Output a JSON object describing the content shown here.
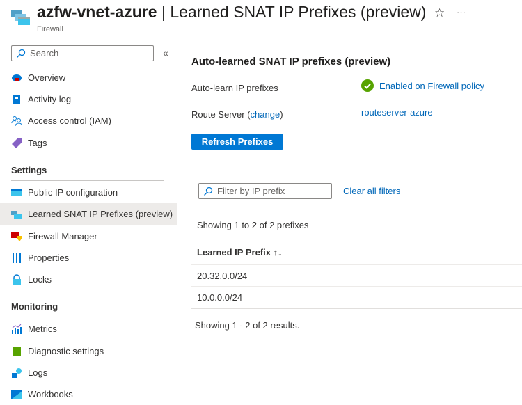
{
  "header": {
    "resource": "azfw-vnet-azure",
    "page": "Learned SNAT IP Prefixes (preview)",
    "separator": "|",
    "type": "Firewall",
    "star_icon": "☆",
    "more_icon": "···"
  },
  "sidebar": {
    "search_placeholder": "Search",
    "collapse_icon": "«",
    "items": [
      {
        "label": "Overview"
      },
      {
        "label": "Activity log"
      },
      {
        "label": "Access control (IAM)"
      },
      {
        "label": "Tags"
      }
    ],
    "settings_header": "Settings",
    "settings": [
      {
        "label": "Public IP configuration"
      },
      {
        "label": "Learned SNAT IP Prefixes (preview)"
      },
      {
        "label": "Firewall Manager"
      },
      {
        "label": "Properties"
      },
      {
        "label": "Locks"
      }
    ],
    "monitoring_header": "Monitoring",
    "monitoring": [
      {
        "label": "Metrics"
      },
      {
        "label": "Diagnostic settings"
      },
      {
        "label": "Logs"
      },
      {
        "label": "Workbooks"
      }
    ]
  },
  "main": {
    "heading": "Auto-learned SNAT IP prefixes (preview)",
    "auto_learn_label": "Auto-learn IP prefixes",
    "auto_learn_value": "Enabled on Firewall policy",
    "route_server_label": "Route Server (",
    "route_server_change": "change",
    "route_server_close": ")",
    "route_server_value": "routeserver-azure",
    "refresh_button": "Refresh Prefixes",
    "filter_placeholder": "Filter by IP prefix",
    "clear_filters": "Clear all filters",
    "showing": "Showing 1 to 2 of 2 prefixes",
    "column": "Learned IP Prefix",
    "sort_icon": "↑↓",
    "rows": [
      "20.32.0.0/24",
      "10.0.0.0/24"
    ],
    "footer": "Showing 1 - 2 of 2 results."
  },
  "colors": {
    "accent": "#0078d4",
    "link": "#0067b8",
    "success": "#57a300"
  }
}
